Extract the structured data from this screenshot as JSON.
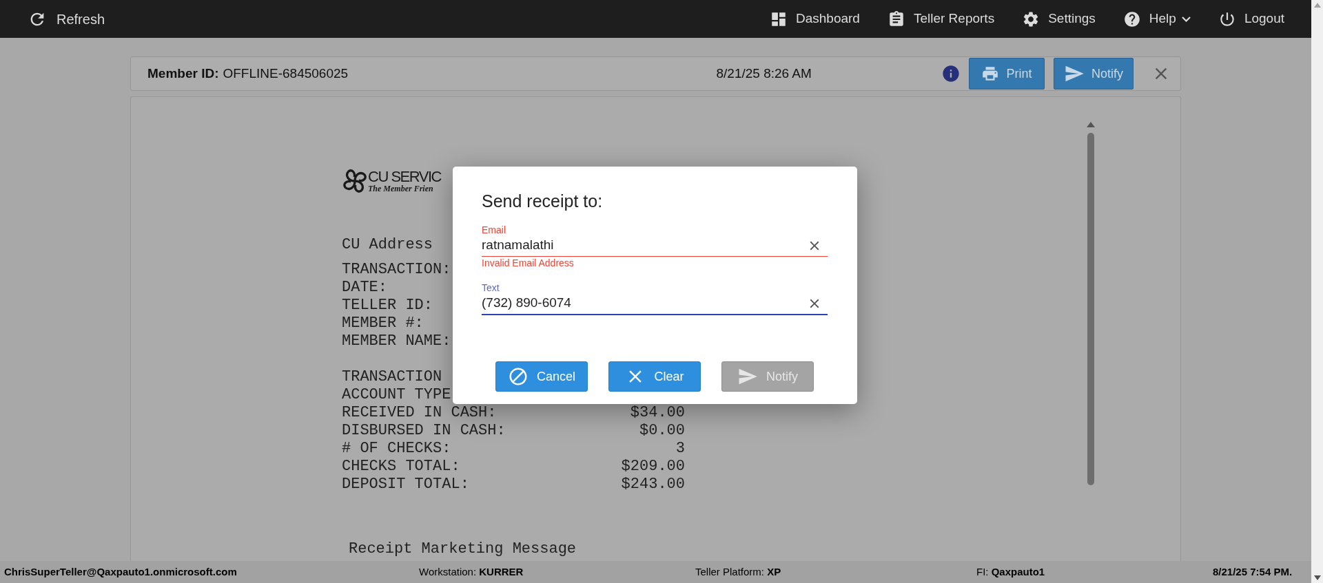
{
  "top_bar": {
    "refresh": {
      "label": "Refresh"
    },
    "nav": [
      {
        "label": "Dashboard",
        "kind": "dashboard",
        "has_menu": false
      },
      {
        "label": "Teller Reports",
        "kind": "reports",
        "has_menu": false
      },
      {
        "label": "Settings",
        "kind": "settings",
        "has_menu": false
      },
      {
        "label": "Help",
        "kind": "help",
        "has_menu": true
      },
      {
        "label": "Logout",
        "kind": "logout",
        "has_menu": false
      }
    ]
  },
  "receipt_header": {
    "member_id_label": "Member ID:",
    "member_id": "OFFLINE-684506025",
    "timestamp": "8/21/25 8:26 AM",
    "buttons": [
      {
        "label": "Print",
        "kind": "print"
      },
      {
        "label": "Notify",
        "kind": "notify"
      }
    ]
  },
  "receipt": {
    "logo": {
      "name": "CU SERVIC",
      "tagline": "The Member Frien"
    },
    "address": "CU Address",
    "sections": [
      [
        {
          "label": "TRANSACTION:"
        },
        {
          "label": "DATE:"
        },
        {
          "label": "TELLER ID:"
        },
        {
          "label": "MEMBER #:"
        },
        {
          "label": "MEMBER NAME:"
        }
      ],
      [
        {
          "label": "TRANSACTION"
        },
        {
          "label": "ACCOUNT TYPE"
        },
        {
          "label": "RECEIVED IN CASH:",
          "value": "$34.00"
        },
        {
          "label": "DISBURSED IN CASH:",
          "value": "$0.00"
        },
        {
          "label": "# OF CHECKS:",
          "value": "3"
        },
        {
          "label": "CHECKS TOTAL:",
          "value": "$209.00"
        },
        {
          "label": "DEPOSIT TOTAL:",
          "value": "$243.00"
        }
      ]
    ],
    "marketing_message": "Receipt Marketing Message"
  },
  "dialog": {
    "title": "Send receipt to:",
    "fields": [
      {
        "label": "Email",
        "value": "ratnamalathi",
        "error_text": "Invalid Email Address",
        "focused": false
      },
      {
        "label": "Text",
        "value": "(732) 890-6074",
        "focused": true
      }
    ],
    "buttons": [
      {
        "label": "Cancel",
        "kind": "cancel",
        "disabled": false
      },
      {
        "label": "Clear",
        "kind": "clear",
        "disabled": false
      },
      {
        "label": "Notify",
        "kind": "notify",
        "disabled": true
      }
    ]
  },
  "status_bar": {
    "user": "ChrisSuperTeller@Qaxpauto1.onmicrosoft.com",
    "items": [
      {
        "label": "Workstation:",
        "value": "KURRER"
      },
      {
        "label": "Teller Platform:",
        "value": "XP"
      },
      {
        "label": "FI:",
        "value": "Qaxpauto1"
      }
    ],
    "time": "8/21/25 7:54 PM."
  }
}
